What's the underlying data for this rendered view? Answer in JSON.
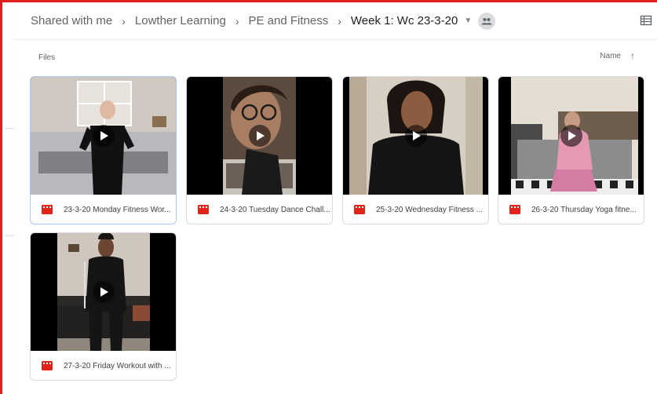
{
  "breadcrumb": {
    "items": [
      "Shared with me",
      "Lowther Learning",
      "PE and Fitness"
    ],
    "current": "Week 1: Wc 23-3-20"
  },
  "icons": {
    "separator": "chevron-right-icon",
    "dropdown": "caret-down-icon",
    "shared": "shared-folder-people-icon",
    "details": "details-view-icon",
    "sort": "arrow-up-icon",
    "file_type": "video-file-icon",
    "play": "play-icon"
  },
  "section": {
    "label": "Files"
  },
  "sort": {
    "label": "Name",
    "direction": "ascending"
  },
  "files": [
    {
      "name": "23-3-20 Monday Fitness Wor...",
      "selected": true
    },
    {
      "name": "24-3-20 Tuesday Dance Chall...",
      "selected": false
    },
    {
      "name": "25-3-20 Wednesday Fitness ...",
      "selected": false
    },
    {
      "name": "26-3-20 Thursday Yoga fitne...",
      "selected": false
    },
    {
      "name": "27-3-20 Friday Workout with ...",
      "selected": false
    }
  ],
  "colors": {
    "frame": "#e01e1e",
    "video_icon": "#e2231a",
    "selected_border": "#a8c7fa"
  }
}
